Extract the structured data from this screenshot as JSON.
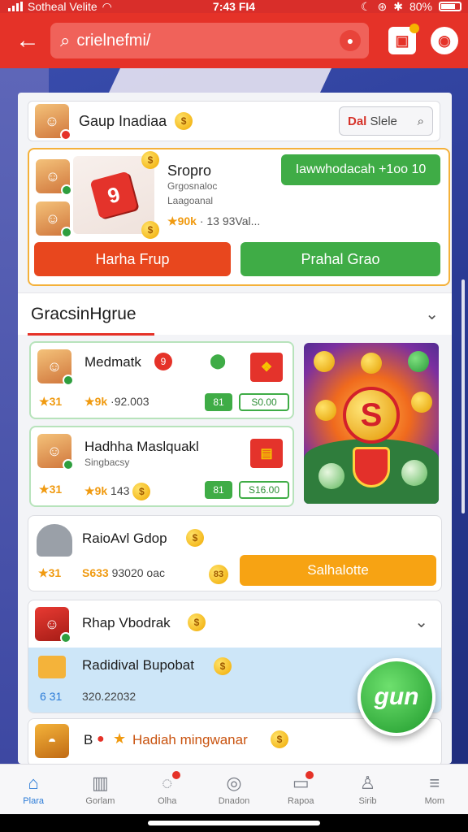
{
  "status_bar": {
    "carrier": "Sotheal Velite",
    "time": "7:43 FI4",
    "battery": "80%"
  },
  "header": {
    "search_placeholder": "crielnefmi/"
  },
  "group": {
    "title": "Gaup Inadiaa",
    "store_label": "Dal",
    "store_text": "Slele"
  },
  "featured": {
    "title": "Sropro",
    "sub1": "Grgosnaloc",
    "sub2": "Laagoanal",
    "rating": "90k",
    "rating_rest": "· 13 93Val...",
    "install_label": "Iawwhodacah +1oo",
    "install_badge": "10",
    "play_label": "Harha Frup",
    "join_label": "Prahal Grao"
  },
  "section": {
    "title": "GracsinHgrue"
  },
  "items": [
    {
      "name": "Medmatk",
      "rating": "31",
      "rating2": "9k",
      "meta": "·92.003",
      "tag": "81",
      "price": "S0.00"
    },
    {
      "name": "Hadhha Maslquakl",
      "sub": "Singbacsy",
      "rating": "31",
      "rating2": "9k",
      "meta": "143",
      "tag": "81",
      "price": "S16.00"
    },
    {
      "name": "RaioAvl Gdop",
      "rating": "31",
      "price_label": "S633",
      "meta": "93020 oac",
      "tag": "83",
      "action": "Salhalotte"
    }
  ],
  "group2": {
    "title": "Rhap Vbodrak",
    "item_title": "Radidival Bupobat",
    "item_num": "6 31",
    "item_meta": "320.22032",
    "last_title": "Hadiah mingwanar",
    "last_prefix": "B"
  },
  "fab": {
    "label": "gun"
  },
  "bottom_nav": [
    {
      "label": "Plara",
      "icon": "home-icon"
    },
    {
      "label": "Gorlam",
      "icon": "book-icon"
    },
    {
      "label": "Olha",
      "icon": "chat-icon"
    },
    {
      "label": "Dnadon",
      "icon": "compass-icon"
    },
    {
      "label": "Rapoa",
      "icon": "inbox-icon"
    },
    {
      "label": "Sirib",
      "icon": "profile-icon"
    },
    {
      "label": "Mom",
      "icon": "menu-icon"
    }
  ],
  "colors": {
    "accent_red": "#e53228",
    "accent_green": "#3fac46",
    "accent_orange": "#f7a313",
    "active_blue": "#2b7bd7"
  }
}
